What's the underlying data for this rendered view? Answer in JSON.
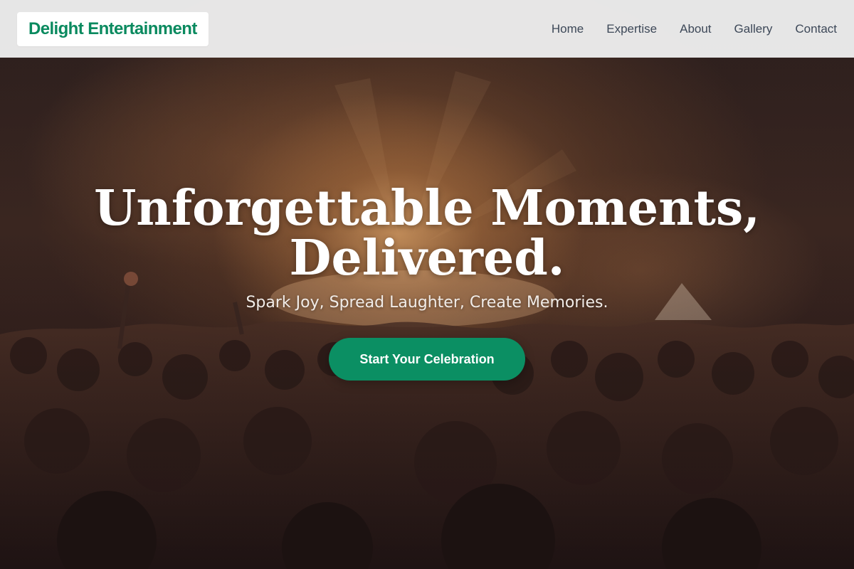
{
  "brand": {
    "name": "Delight Entertainment",
    "color": "#0a8a5f"
  },
  "nav": {
    "items": [
      {
        "label": "Home"
      },
      {
        "label": "Expertise"
      },
      {
        "label": "About"
      },
      {
        "label": "Gallery"
      },
      {
        "label": "Contact"
      }
    ]
  },
  "hero": {
    "headline_line1": "Unforgettable Moments,",
    "headline_line2": "Delivered.",
    "tagline": "Spark Joy, Spread Laughter, Create Memories.",
    "cta_label": "Start Your Celebration",
    "cta_color": "#0b8f63",
    "background_image": "concert-crowd-photo"
  }
}
